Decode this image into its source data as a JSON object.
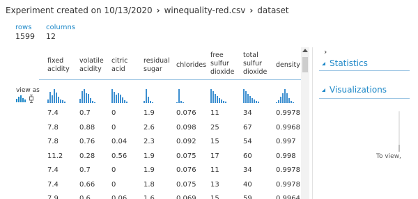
{
  "breadcrumb": {
    "experiment": "Experiment created on 10/13/2020",
    "file": "winequality-red.csv",
    "leaf": "dataset"
  },
  "summary": {
    "rows_label": "rows",
    "rows_value": "1599",
    "columns_label": "columns",
    "columns_value": "12"
  },
  "view_as_label": "view as",
  "columns": [
    {
      "header": [
        "fixed",
        "acidity"
      ]
    },
    {
      "header": [
        "volatile",
        "acidity"
      ]
    },
    {
      "header": [
        "citric",
        "acid"
      ]
    },
    {
      "header": [
        "residual",
        "sugar"
      ]
    },
    {
      "header": [
        "chlorides"
      ]
    },
    {
      "header": [
        "free",
        "sulfur",
        "dioxide"
      ]
    },
    {
      "header": [
        "total",
        "sulfur",
        "dioxide"
      ]
    },
    {
      "header": [
        "density"
      ]
    }
  ],
  "rows": [
    [
      "7.4",
      "0.7",
      "0",
      "1.9",
      "0.076",
      "11",
      "34",
      "0.9978"
    ],
    [
      "7.8",
      "0.88",
      "0",
      "2.6",
      "0.098",
      "25",
      "67",
      "0.9968"
    ],
    [
      "7.8",
      "0.76",
      "0.04",
      "2.3",
      "0.092",
      "15",
      "54",
      "0.997"
    ],
    [
      "11.2",
      "0.28",
      "0.56",
      "1.9",
      "0.075",
      "17",
      "60",
      "0.998"
    ],
    [
      "7.4",
      "0.7",
      "0",
      "1.9",
      "0.076",
      "11",
      "34",
      "0.9978"
    ],
    [
      "7.4",
      "0.66",
      "0",
      "1.8",
      "0.075",
      "13",
      "40",
      "0.9978"
    ],
    [
      "7.9",
      "0.6",
      "0.06",
      "1.6",
      "0.069",
      "15",
      "59",
      "0.9964"
    ]
  ],
  "histograms": [
    [
      3,
      9,
      6,
      11,
      8,
      5,
      3,
      2,
      1
    ],
    [
      4,
      12,
      14,
      10,
      9,
      5,
      2,
      1
    ],
    [
      10,
      8,
      6,
      7,
      6,
      4,
      2,
      1
    ],
    [
      2,
      14,
      6,
      2,
      1
    ],
    [
      1,
      14,
      2,
      1
    ],
    [
      12,
      10,
      8,
      6,
      4,
      3,
      2,
      1
    ],
    [
      12,
      10,
      8,
      6,
      4,
      3,
      2,
      1
    ],
    [
      1,
      3,
      6,
      10,
      14,
      10,
      5,
      2,
      1
    ]
  ],
  "right_panel": {
    "statistics": "Statistics",
    "visualizations": "Visualizations",
    "to_view": "To view,"
  },
  "colors": {
    "accent": "#1e88c8",
    "histogram": "#3d8fd0"
  }
}
